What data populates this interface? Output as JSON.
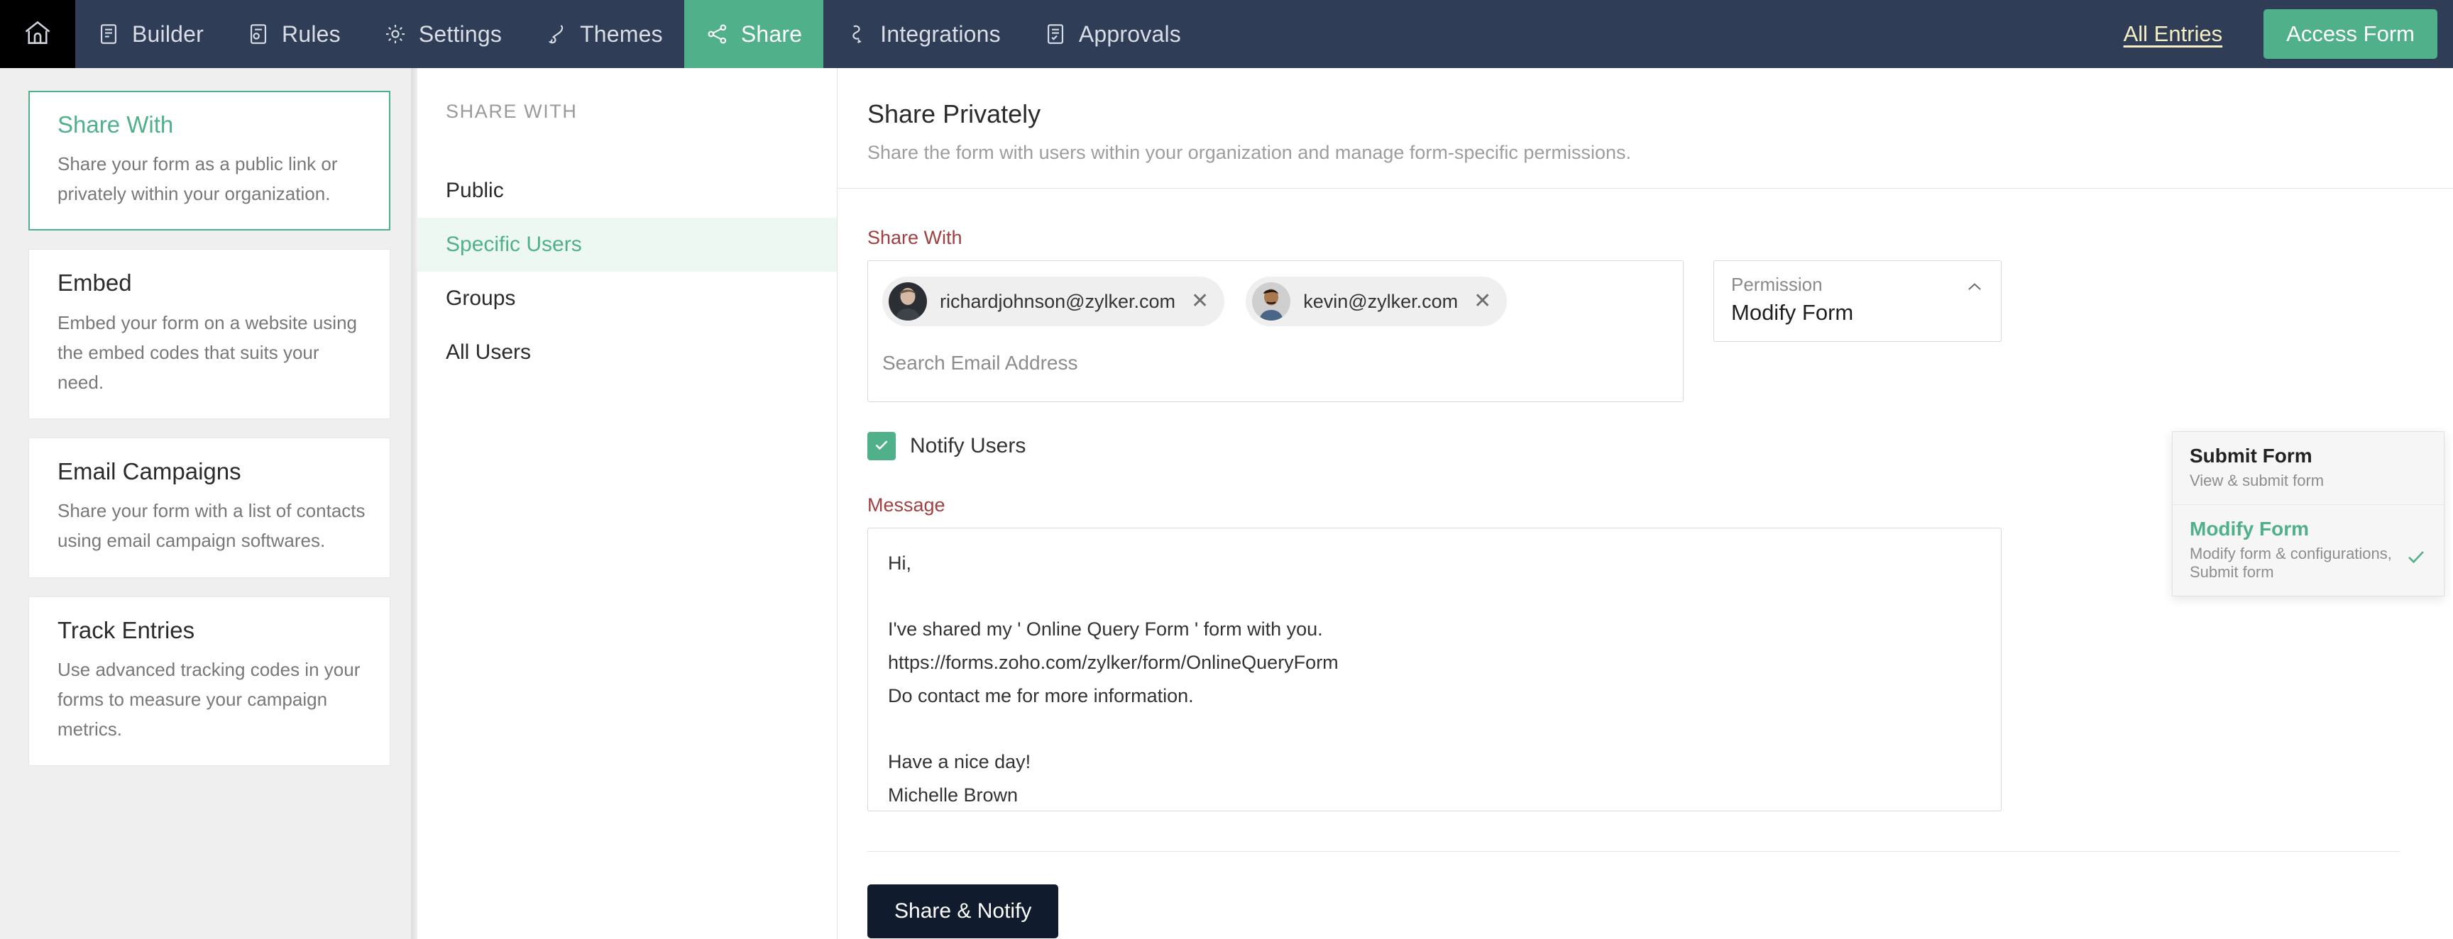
{
  "topnav": {
    "home_icon": "home-icon",
    "items": [
      {
        "label": "Builder",
        "icon": "builder-icon",
        "active": false
      },
      {
        "label": "Rules",
        "icon": "rules-icon",
        "active": false
      },
      {
        "label": "Settings",
        "icon": "gear-icon",
        "active": false
      },
      {
        "label": "Themes",
        "icon": "brush-icon",
        "active": false
      },
      {
        "label": "Share",
        "icon": "share-icon",
        "active": true
      },
      {
        "label": "Integrations",
        "icon": "integrations-icon",
        "active": false
      },
      {
        "label": "Approvals",
        "icon": "approvals-icon",
        "active": false
      }
    ],
    "all_entries": "All Entries",
    "access_form": "Access Form",
    "bg_color": "#303d57",
    "accent_color": "#4fb08a",
    "link_color": "#f5eec2"
  },
  "rail": {
    "cards": [
      {
        "title": "Share With",
        "desc": "Share your form as a public link or privately within your organization.",
        "selected": true
      },
      {
        "title": "Embed",
        "desc": "Embed your form on a website using the embed codes that suits your need.",
        "selected": false
      },
      {
        "title": "Email Campaigns",
        "desc": "Share your form with a list of contacts using email campaign softwares.",
        "selected": false
      },
      {
        "title": "Track Entries",
        "desc": "Use advanced tracking codes in your forms to measure your campaign metrics.",
        "selected": false
      }
    ]
  },
  "subnav": {
    "heading": "SHARE WITH",
    "items": [
      {
        "label": "Public",
        "active": false
      },
      {
        "label": "Specific Users",
        "active": true
      },
      {
        "label": "Groups",
        "active": false
      },
      {
        "label": "All Users",
        "active": false
      }
    ]
  },
  "main": {
    "title": "Share Privately",
    "subtitle": "Share the form with users within your organization and manage form-specific permissions.",
    "share_with_label": "Share With",
    "chips": [
      {
        "email": "richardjohnson@zylker.com",
        "remove_icon": "close-icon"
      },
      {
        "email": "kevin@zylker.com",
        "remove_icon": "close-icon"
      }
    ],
    "search_placeholder": "Search Email Address",
    "permission": {
      "label": "Permission",
      "value": "Modify Form",
      "caret_icon": "chevron-up-icon",
      "options": [
        {
          "title": "Submit Form",
          "desc": "View & submit form",
          "selected": false
        },
        {
          "title": "Modify Form",
          "desc": "Modify form & configurations, Submit form",
          "selected": true
        }
      ]
    },
    "notify": {
      "label": "Notify Users",
      "checked": true,
      "check_icon": "check-icon"
    },
    "message_label": "Message",
    "message_value": "Hi,\n\nI've shared my ' Online Query Form ' form with you.\nhttps://forms.zoho.com/zylker/form/OnlineQueryForm\nDo contact me for more information.\n\nHave a nice day!\nMichelle Brown",
    "submit_label": "Share & Notify",
    "label_color": "#a04040",
    "submit_bg": "#101c2e"
  }
}
